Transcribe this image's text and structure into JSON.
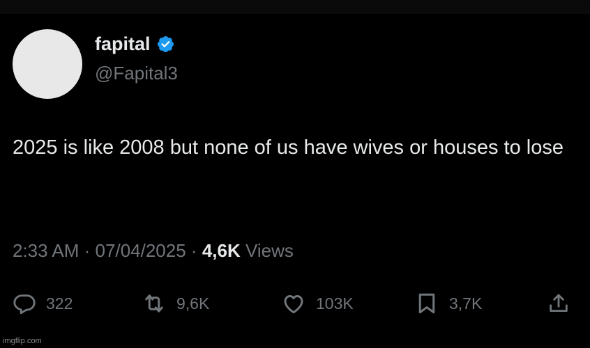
{
  "author": {
    "display_name": "fapital",
    "handle": "@Fapital3",
    "verified": true
  },
  "tweet": {
    "text": "2025 is like 2008 but none of us have wives or houses to lose"
  },
  "meta": {
    "time": "2:33 AM",
    "separator": "·",
    "date": "07/04/2025",
    "views_count": "4,6K",
    "views_label": "Views"
  },
  "actions": {
    "replies": "322",
    "reposts": "9,6K",
    "likes": "103K",
    "bookmarks": "3,7K"
  },
  "watermark": "imgflip.com",
  "colors": {
    "background": "#000000",
    "primary_text": "#e7e9ea",
    "secondary_text": "#71767b",
    "verified_badge": "#1d9bf0"
  }
}
